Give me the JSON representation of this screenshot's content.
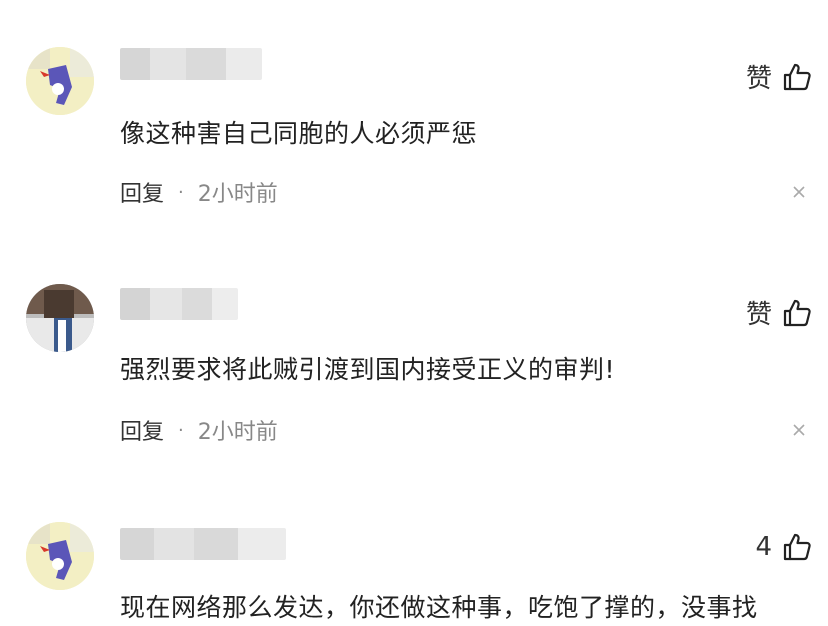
{
  "comments": [
    {
      "like_label": "赞",
      "content": "像这种害自己同胞的人必须严惩",
      "reply_label": "回复",
      "separator": "·",
      "time": "2小时前",
      "avatar": "cartoon-avatar"
    },
    {
      "like_label": "赞",
      "content": "强烈要求将此贼引渡到国内接受正义的审判!",
      "reply_label": "回复",
      "separator": "·",
      "time": "2小时前",
      "avatar": "photo-avatar"
    },
    {
      "like_count": "4",
      "content": "现在网络那么发达，你还做这种事，吃饱了撑的，没事找",
      "avatar": "cartoon-avatar"
    }
  ],
  "icons": {
    "like": "thumbs-up-icon",
    "close": "close-icon"
  },
  "colors": {
    "text": "#222222",
    "meta": "#888888",
    "background": "#ffffff"
  }
}
